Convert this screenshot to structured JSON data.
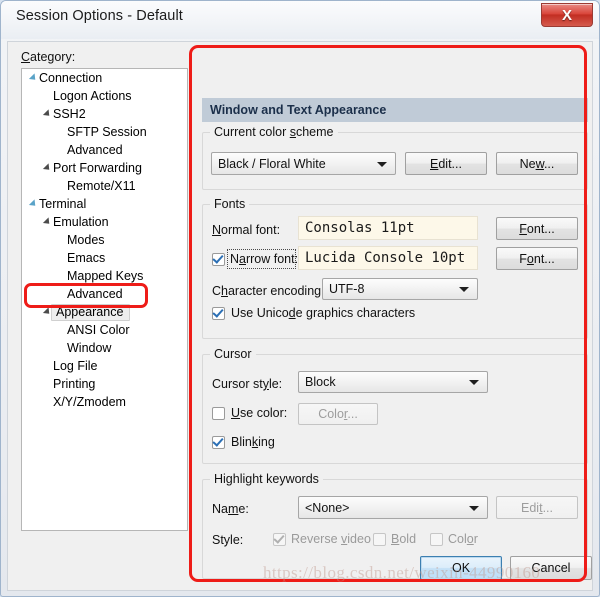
{
  "window": {
    "title": "Session Options - Default",
    "close_label": "X"
  },
  "category": {
    "label": "Category:",
    "items": [
      {
        "label": "Connection",
        "indent": 0,
        "expander": "expanded",
        "selected": false
      },
      {
        "label": "Logon Actions",
        "indent": 1,
        "expander": "none",
        "selected": false
      },
      {
        "label": "SSH2",
        "indent": 1,
        "expander": "expanded",
        "selected": false
      },
      {
        "label": "SFTP Session",
        "indent": 2,
        "expander": "none",
        "selected": false
      },
      {
        "label": "Advanced",
        "indent": 2,
        "expander": "none",
        "selected": false
      },
      {
        "label": "Port Forwarding",
        "indent": 1,
        "expander": "expanded",
        "selected": false
      },
      {
        "label": "Remote/X11",
        "indent": 2,
        "expander": "none",
        "selected": false
      },
      {
        "label": "Terminal",
        "indent": 0,
        "expander": "expanded",
        "selected": false
      },
      {
        "label": "Emulation",
        "indent": 1,
        "expander": "expanded",
        "selected": false
      },
      {
        "label": "Modes",
        "indent": 2,
        "expander": "none",
        "selected": false
      },
      {
        "label": "Emacs",
        "indent": 2,
        "expander": "none",
        "selected": false
      },
      {
        "label": "Mapped Keys",
        "indent": 2,
        "expander": "none",
        "selected": false
      },
      {
        "label": "Advanced",
        "indent": 2,
        "expander": "none",
        "selected": false
      },
      {
        "label": "Appearance",
        "indent": 1,
        "expander": "expanded",
        "selected": true
      },
      {
        "label": "ANSI Color",
        "indent": 2,
        "expander": "none",
        "selected": false
      },
      {
        "label": "Window",
        "indent": 2,
        "expander": "none",
        "selected": false
      },
      {
        "label": "Log File",
        "indent": 1,
        "expander": "none",
        "selected": false
      },
      {
        "label": "Printing",
        "indent": 1,
        "expander": "none",
        "selected": false
      },
      {
        "label": "X/Y/Zmodem",
        "indent": 1,
        "expander": "none",
        "selected": false
      }
    ]
  },
  "panel": {
    "header": "Window and Text Appearance",
    "color_scheme": {
      "group_title": "Current color scheme",
      "selected": "Black / Floral White",
      "edit_button": "Edit...",
      "new_button": "New..."
    },
    "fonts": {
      "group_title": "Fonts",
      "normal_font_label": "Normal font:",
      "normal_font_value": "Consolas 11pt",
      "normal_font_button": "Font...",
      "narrow_font_label": "Narrow font:",
      "narrow_font_checked": true,
      "narrow_font_value": "Lucida Console 10pt",
      "narrow_font_button": "Font...",
      "encoding_label": "Character encoding:",
      "encoding_value": "UTF-8",
      "unicode_label": "Use Unicode graphics characters",
      "unicode_checked": true
    },
    "cursor": {
      "group_title": "Cursor",
      "style_label": "Cursor style:",
      "style_value": "Block",
      "use_color_label": "Use color:",
      "use_color_checked": false,
      "color_button": "Color...",
      "blinking_label": "Blinking",
      "blinking_checked": true
    },
    "highlight": {
      "group_title": "Highlight keywords",
      "name_label": "Name:",
      "name_value": "<None>",
      "edit_button": "Edit...",
      "style_label": "Style:",
      "reverse_video_label": "Reverse video",
      "reverse_video_checked": true,
      "bold_label": "Bold",
      "bold_checked": false,
      "color_label": "Color",
      "color_checked": false
    }
  },
  "footer": {
    "ok_button": "OK",
    "cancel_button": "Cancel"
  },
  "watermark": "https://blog.csdn.net/weixin-44990160",
  "colors": {
    "annotation": "#ee1c18",
    "panel_header_bg": "#c0cbd7",
    "panel_header_text": "#1b2f4a",
    "font_preview_bg": "#fdf8e9",
    "checkbox_check": "#2b6fb5",
    "default_button_border": "#3c7fb1"
  }
}
